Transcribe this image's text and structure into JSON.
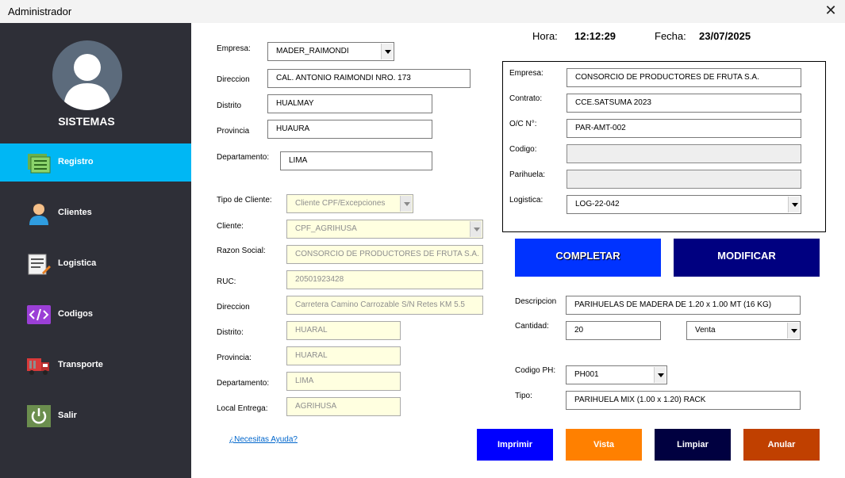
{
  "window": {
    "title": "Administrador"
  },
  "sidebar": {
    "user_label": "SISTEMAS",
    "items": [
      {
        "label": "Registro",
        "icon": "registry-icon",
        "active": true
      },
      {
        "label": "Clientes",
        "icon": "client-icon",
        "active": false
      },
      {
        "label": "Logistica",
        "icon": "logistics-icon",
        "active": false
      },
      {
        "label": "Codigos",
        "icon": "code-icon",
        "active": false
      },
      {
        "label": "Transporte",
        "icon": "truck-icon",
        "active": false
      },
      {
        "label": "Salir",
        "icon": "power-icon",
        "active": false
      }
    ]
  },
  "header": {
    "hora_label": "Hora:",
    "hora_value": "12:12:29",
    "fecha_label": "Fecha:",
    "fecha_value": "23/07/2025"
  },
  "empresa_form": {
    "empresa_label": "Empresa:",
    "empresa_value": "MADER_RAIMONDI",
    "direccion_label": "Direccion",
    "direccion_value": "CAL. ANTONIO RAIMONDI NRO. 173",
    "distrito_label": "Distrito",
    "distrito_value": "HUALMAY",
    "provincia_label": "Provincia",
    "provincia_value": "HUAURA",
    "departamento_label": "Departamento:",
    "departamento_value": "LIMA"
  },
  "cliente_form": {
    "tipo_label": "Tipo de Cliente:",
    "tipo_value": "Cliente CPF/Excepciones",
    "cliente_label": "Cliente:",
    "cliente_value": "CPF_AGRIHUSA",
    "razon_label": "Razon Social:",
    "razon_value": "CONSORCIO DE PRODUCTORES DE FRUTA S.A.",
    "ruc_label": "RUC:",
    "ruc_value": "20501923428",
    "direccion_label": "Direccion",
    "direccion_value": "Carretera Camino Carrozable S/N Retes KM 5.5",
    "distrito_label": "Distrito:",
    "distrito_value": "HUARAL",
    "provincia_label": "Provincia:",
    "provincia_value": "HUARAL",
    "departamento_label": "Departamento:",
    "departamento_value": "LIMA",
    "local_label": "Local Entrega:",
    "local_value": "AGRIHUSA"
  },
  "contrato_panel": {
    "empresa_label": "Empresa:",
    "empresa_value": "CONSORCIO DE PRODUCTORES DE FRUTA S.A.",
    "contrato_label": "Contrato:",
    "contrato_value": "CCE.SATSUMA 2023",
    "oc_label": "O/C N°:",
    "oc_value": "PAR-AMT-002",
    "codigo_label": "Codigo:",
    "codigo_value": "",
    "parihuela_label": "Parihuela:",
    "parihuela_value": "",
    "logistica_label": "Logistica:",
    "logistica_value": "LOG-22-042"
  },
  "actions": {
    "completar_label": "COMPLETAR",
    "modificar_label": "MODIFICAR"
  },
  "detalle": {
    "descripcion_label": "Descripcion",
    "descripcion_value": "PARIHUELAS DE MADERA DE 1.20 x 1.00 MT (16 KG)",
    "cantidad_label": "Cantidad:",
    "cantidad_value": "20",
    "tipo_venta_value": "Venta",
    "codigo_ph_label": "Codigo PH:",
    "codigo_ph_value": "PH001",
    "tipo_label": "Tipo:",
    "tipo_value": "PARIHUELA MIX (1.00 x 1.20) RACK"
  },
  "footer": {
    "help_label": "¿Necesitas Ayuda?",
    "imprimir_label": "Imprimir",
    "vista_label": "Vista",
    "limpiar_label": "Limpiar",
    "anular_label": "Anular"
  },
  "colors": {
    "sidebar_bg": "#2e2f37",
    "active_item": "#00b7f4",
    "completar": "#0033ff",
    "modificar": "#000080",
    "imprimir": "#0000ff",
    "vista": "#ff8000",
    "limpiar": "#000040",
    "anular": "#c04000",
    "disabled_field": "#ffffe0"
  }
}
